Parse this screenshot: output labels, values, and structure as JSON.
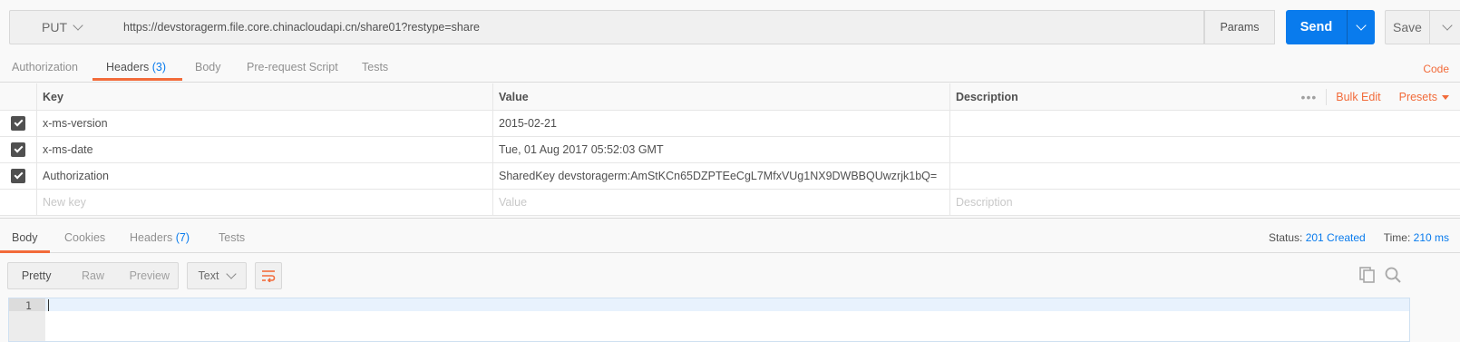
{
  "request": {
    "method": "PUT",
    "url": "https://devstoragerm.file.core.chinacloudapi.cn/share01?restype=share",
    "params_label": "Params",
    "send_label": "Send",
    "save_label": "Save"
  },
  "request_tabs": [
    {
      "label": "Authorization",
      "count": ""
    },
    {
      "label": "Headers",
      "count": "(3)"
    },
    {
      "label": "Body",
      "count": ""
    },
    {
      "label": "Pre-request Script",
      "count": ""
    },
    {
      "label": "Tests",
      "count": ""
    }
  ],
  "active_request_tab": "Headers",
  "code_label": "Code",
  "headers_table": {
    "columns": [
      "Key",
      "Value",
      "Description"
    ],
    "bulk_edit_label": "Bulk Edit",
    "presets_label": "Presets",
    "rows": [
      {
        "checked": true,
        "key": "x-ms-version",
        "value": "2015-02-21",
        "description": ""
      },
      {
        "checked": true,
        "key": "x-ms-date",
        "value": "Tue, 01 Aug 2017 05:52:03 GMT",
        "description": ""
      },
      {
        "checked": true,
        "key": "Authorization",
        "value": "SharedKey devstoragerm:AmStKCn65DZPTEeCgL7MfxVUg1NX9DWBBQUwzrjk1bQ=",
        "description": ""
      }
    ],
    "new_row_placeholders": {
      "key": "New key",
      "value": "Value",
      "description": "Description"
    }
  },
  "response_tabs": [
    {
      "label": "Body",
      "count": ""
    },
    {
      "label": "Cookies",
      "count": ""
    },
    {
      "label": "Headers",
      "count": "(7)"
    },
    {
      "label": "Tests",
      "count": ""
    }
  ],
  "active_response_tab": "Body",
  "response_status": {
    "status_label": "Status:",
    "status_value": "201 Created",
    "time_label": "Time:",
    "time_value": "210 ms"
  },
  "response_toolbar": {
    "formats": [
      "Pretty",
      "Raw",
      "Preview"
    ],
    "active_format": "Pretty",
    "text_type": "Text"
  },
  "editor": {
    "line_number": "1"
  },
  "colors": {
    "accent_orange": "#f26b3a",
    "send_blue": "#097bed",
    "link_blue": "#097bed"
  }
}
